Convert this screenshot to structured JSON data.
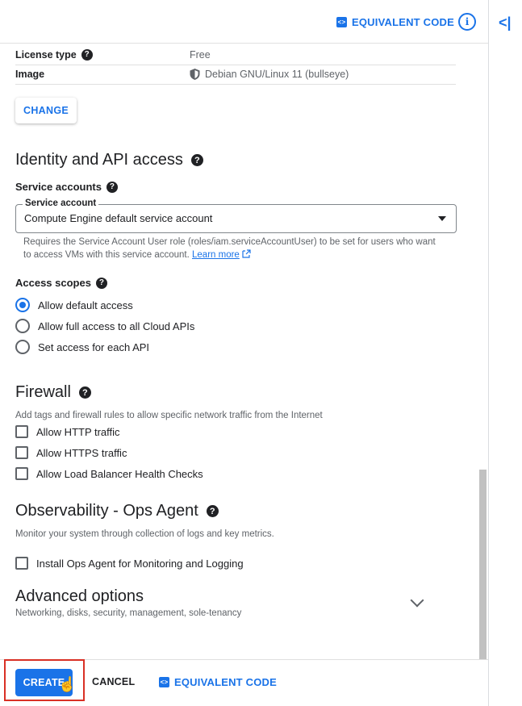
{
  "topbar": {
    "equivalent_code": "EQUIVALENT CODE",
    "info_icon": "info-icon"
  },
  "image_info": {
    "license_label": "License type",
    "license_value": "Free",
    "image_label": "Image",
    "image_value": "Debian GNU/Linux 11 (bullseye)"
  },
  "change_button": "CHANGE",
  "identity": {
    "title": "Identity and API access",
    "service_accounts_label": "Service accounts",
    "service_account_legend": "Service account",
    "service_account_value": "Compute Engine default service account",
    "hint": "Requires the Service Account User role (roles/iam.serviceAccountUser) to be set for users who want to access VMs with this service account.",
    "learn_more": "Learn more",
    "access_scopes_label": "Access scopes",
    "scopes": [
      {
        "label": "Allow default access",
        "selected": true
      },
      {
        "label": "Allow full access to all Cloud APIs",
        "selected": false
      },
      {
        "label": "Set access for each API",
        "selected": false
      }
    ]
  },
  "firewall": {
    "title": "Firewall",
    "desc": "Add tags and firewall rules to allow specific network traffic from the Internet",
    "options": [
      "Allow HTTP traffic",
      "Allow HTTPS traffic",
      "Allow Load Balancer Health Checks"
    ]
  },
  "observability": {
    "title": "Observability - Ops Agent",
    "desc": "Monitor your system through collection of logs and key metrics.",
    "option": "Install Ops Agent for Monitoring and Logging"
  },
  "advanced": {
    "title": "Advanced options",
    "desc": "Networking, disks, security, management, sole-tenancy"
  },
  "footer": {
    "create": "CREATE",
    "cancel": "CANCEL",
    "equivalent_code": "EQUIVALENT CODE"
  },
  "colors": {
    "accent": "#1a73e8",
    "highlight": "#d93025"
  }
}
